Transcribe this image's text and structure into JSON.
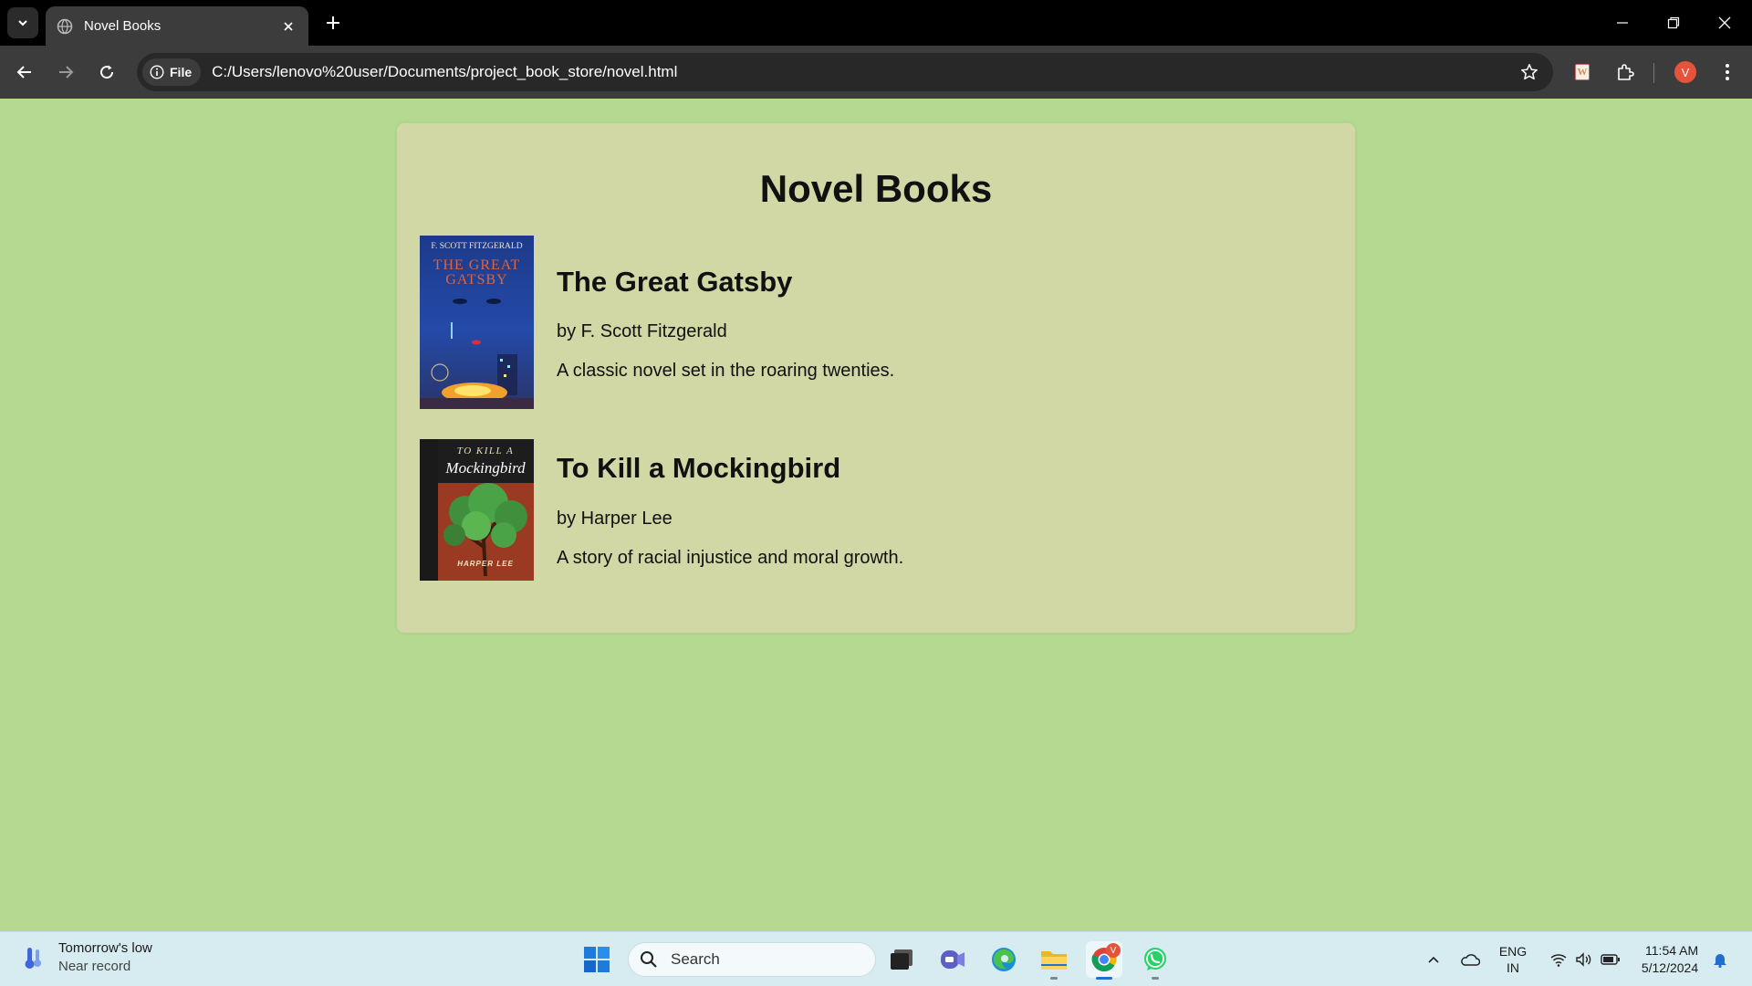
{
  "browser": {
    "tab_title": "Novel Books",
    "security_chip_label": "File",
    "url": "C:/Users/lenovo%20user/Documents/project_book_store/novel.html",
    "profile_initial": "V"
  },
  "page": {
    "title": "Novel Books",
    "books": [
      {
        "title": "The Great Gatsby",
        "author": "by F. Scott Fitzgerald",
        "description": "A classic novel set in the roaring twenties.",
        "cover_text": [
          "F. SCOTT FITZGERALD",
          "THE GREAT",
          "GATSBY"
        ]
      },
      {
        "title": "To Kill a Mockingbird",
        "author": "by Harper Lee",
        "description": "A story of racial injustice and moral growth.",
        "cover_text": [
          "TO KILL A",
          "Mockingbird",
          "HARPER LEE"
        ]
      }
    ]
  },
  "taskbar": {
    "weather_line1": "Tomorrow's low",
    "weather_line2": "Near record",
    "search_placeholder": "Search",
    "lang_line1": "ENG",
    "lang_line2": "IN",
    "time": "11:54 AM",
    "date": "5/12/2024",
    "chrome_badge": "V"
  },
  "colors": {
    "page_bg": "#b5d991",
    "card_bg": "#d1d8a6",
    "chrome_dark": "#3c3c3c",
    "taskbar_bg": "#d7ecf0"
  }
}
